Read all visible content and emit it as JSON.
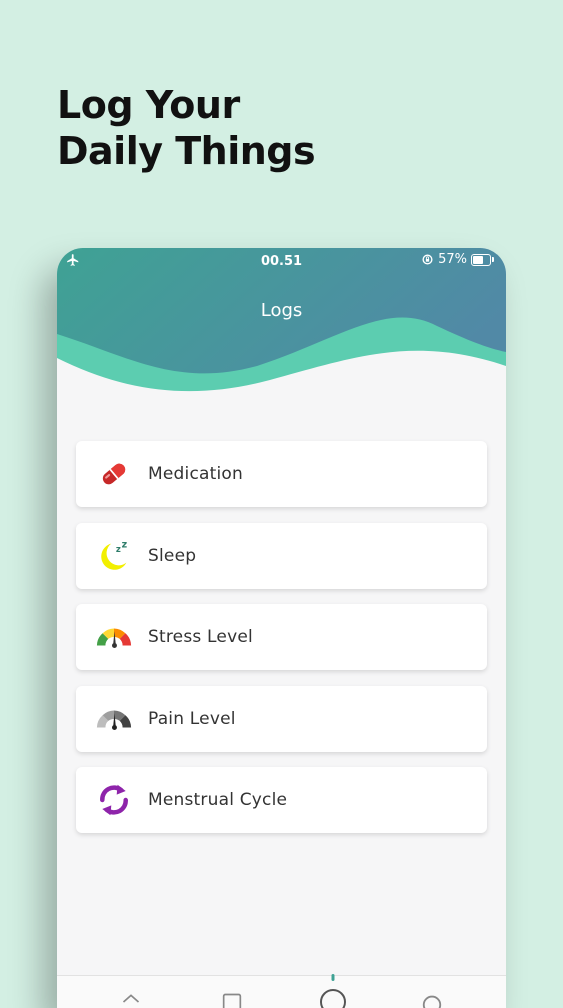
{
  "headline": {
    "line1": "Log Your",
    "line2": "Daily Things"
  },
  "status_bar": {
    "time": "00.51",
    "battery": "57%"
  },
  "header": {
    "title": "Logs"
  },
  "logs": [
    {
      "label": "Medication",
      "icon": "pill-icon"
    },
    {
      "label": "Sleep",
      "icon": "moon-sleep-icon"
    },
    {
      "label": "Stress Level",
      "icon": "stress-gauge-icon"
    },
    {
      "label": "Pain Level",
      "icon": "pain-gauge-icon"
    },
    {
      "label": "Menstrual Cycle",
      "icon": "cycle-icon"
    }
  ],
  "colors": {
    "background": "#d3efe3",
    "header_start": "#3fa294",
    "header_end": "#5189a6",
    "wave": "#5ccdb0",
    "pill": "#c62828",
    "moon": "#f2ef00",
    "cycle": "#8e24aa"
  }
}
